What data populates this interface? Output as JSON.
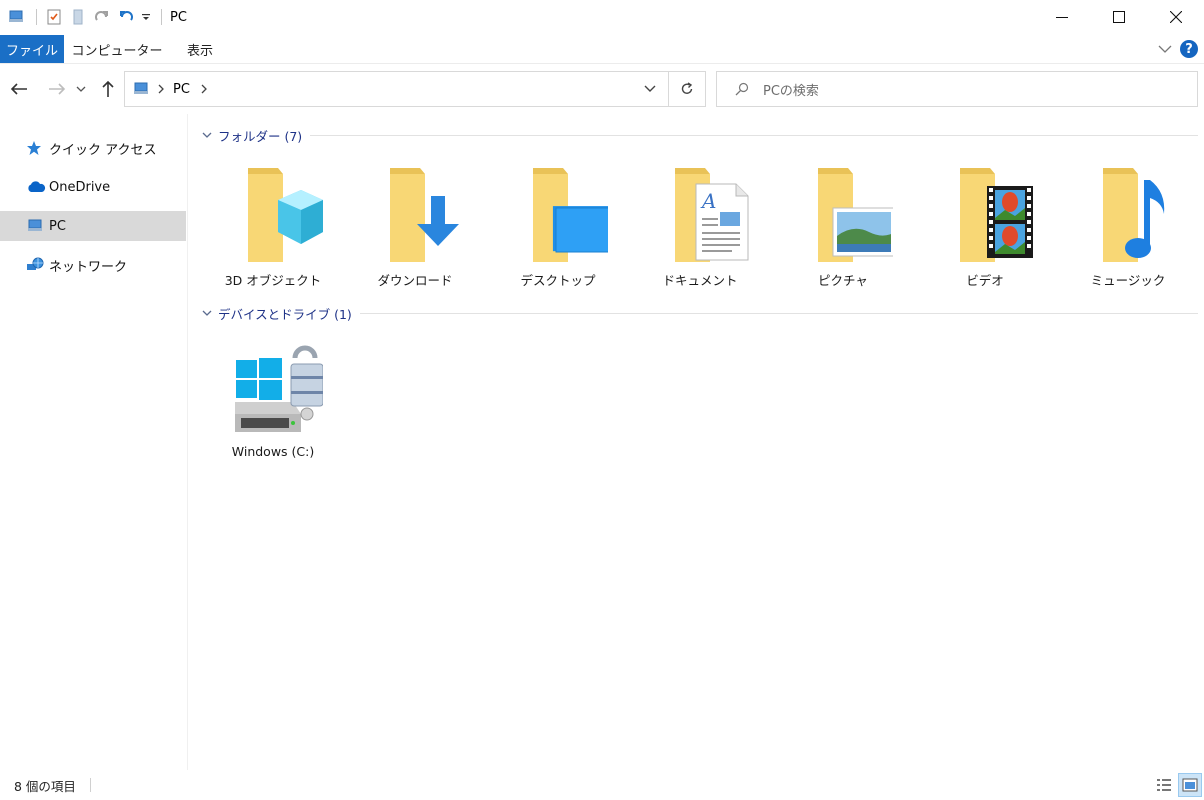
{
  "window": {
    "title": "PC",
    "minimize_glyph": "—",
    "maximize_glyph": "☐",
    "close_glyph": "✕"
  },
  "quick_access_toolbar": {
    "icons": [
      "pc-icon",
      "properties-icon",
      "new-folder-icon",
      "redo-icon",
      "undo-icon",
      "customize-dropdown-icon"
    ]
  },
  "ribbon": {
    "tabs": [
      {
        "label": "ファイル",
        "active": true
      },
      {
        "label": "コンピューター",
        "active": false
      },
      {
        "label": "表示",
        "active": false
      }
    ],
    "help_glyph": "?"
  },
  "navigation": {
    "address_segments": [
      "PC"
    ],
    "search_placeholder": "PCの検索"
  },
  "sidebar": {
    "items": [
      {
        "label": "クイック アクセス",
        "icon": "star-icon",
        "selected": false
      },
      {
        "label": "OneDrive",
        "icon": "cloud-icon",
        "selected": false
      },
      {
        "label": "PC",
        "icon": "pc-icon",
        "selected": true
      },
      {
        "label": "ネットワーク",
        "icon": "network-icon",
        "selected": false
      }
    ]
  },
  "content": {
    "groups": [
      {
        "title": "フォルダー (7)",
        "items": [
          {
            "label": "3D オブジェクト",
            "icon": "3d-objects-folder-icon"
          },
          {
            "label": "ダウンロード",
            "icon": "downloads-folder-icon"
          },
          {
            "label": "デスクトップ",
            "icon": "desktop-folder-icon"
          },
          {
            "label": "ドキュメント",
            "icon": "documents-folder-icon"
          },
          {
            "label": "ピクチャ",
            "icon": "pictures-folder-icon"
          },
          {
            "label": "ビデオ",
            "icon": "videos-folder-icon"
          },
          {
            "label": "ミュージック",
            "icon": "music-folder-icon"
          }
        ]
      },
      {
        "title": "デバイスとドライブ (1)",
        "items": [
          {
            "label": "Windows (C:)",
            "icon": "windows-drive-locked-icon"
          }
        ]
      }
    ]
  },
  "statusbar": {
    "item_count": "8 個の項目",
    "view_modes": [
      "details-view-icon",
      "large-icons-view-icon"
    ],
    "active_view": "large-icons-view-icon"
  },
  "colors": {
    "accent": "#1a6fc6",
    "folder_yellow": "#f8d775",
    "group_header_text": "#1e3287",
    "selection": "#d9d9d9"
  }
}
